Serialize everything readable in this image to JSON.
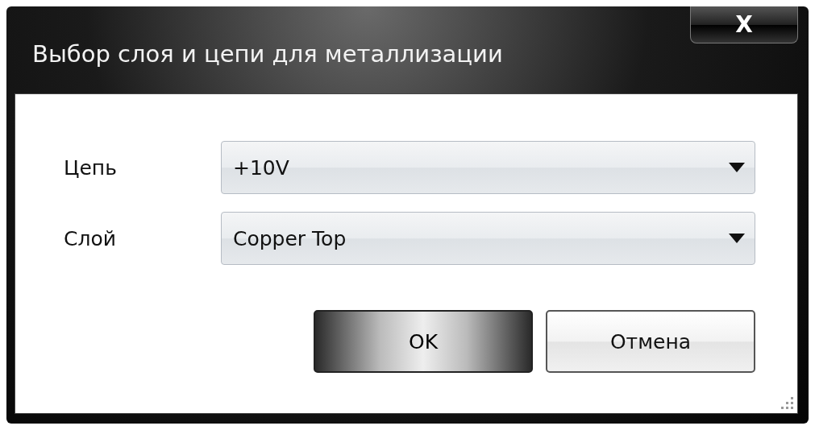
{
  "window": {
    "title": "Выбор слоя и цепи для металлизации",
    "close": "X"
  },
  "fields": [
    {
      "label": "Цепь",
      "value": "+10V"
    },
    {
      "label": "Слой",
      "value": "Copper Top"
    }
  ],
  "buttons": [
    {
      "label": "OK",
      "focused": true
    },
    {
      "label": "Отмена",
      "focused": false
    }
  ]
}
